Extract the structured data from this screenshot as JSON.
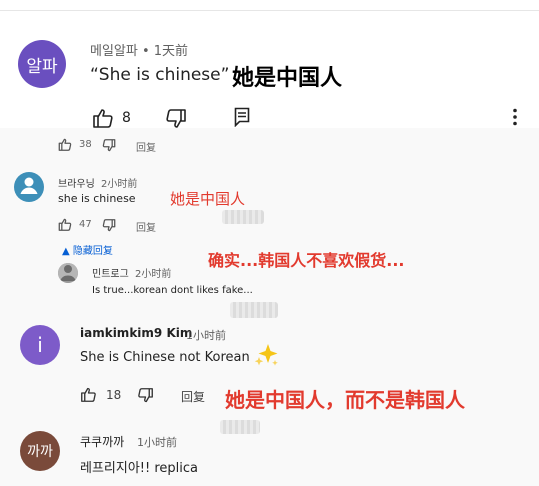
{
  "top_comment": {
    "avatar_text": "알파",
    "avatar_color": "#6a4fbf",
    "author_line": "메일알파 • 1天前",
    "text": "“She is chinese”",
    "likes": "8",
    "annotation": "她是中国人"
  },
  "reply_block": {
    "likes": "38",
    "reply_label": "回复"
  },
  "comment_2": {
    "author": "브라우닝",
    "time": "2小时前",
    "text": "she is chinese",
    "likes": "47",
    "reply_label": "回复",
    "hide_replies": "▲ 隐藏回复",
    "annotation": "她是中国人",
    "avatar_color": "#3d8fb8"
  },
  "comment_2_reply": {
    "author": "민트로그",
    "time": "2小时前",
    "text": "Is true...korean dont likes fake...",
    "annotation": "确实...韩国人不喜欢假货..."
  },
  "comment_3": {
    "avatar_text": "i",
    "avatar_color": "#7d5bc9",
    "author": "iamkimkim9 Kim",
    "time": "1小时前",
    "text": "She is Chinese not Korean",
    "likes": "18",
    "reply_label": "回复",
    "annotation": "她是中国人，而不是韩国人"
  },
  "comment_4": {
    "avatar_text": "까까",
    "avatar_color": "#7a4a3a",
    "author": "쿠쿠까까",
    "time": "1小时前",
    "text": "레프리지아!! replica"
  }
}
